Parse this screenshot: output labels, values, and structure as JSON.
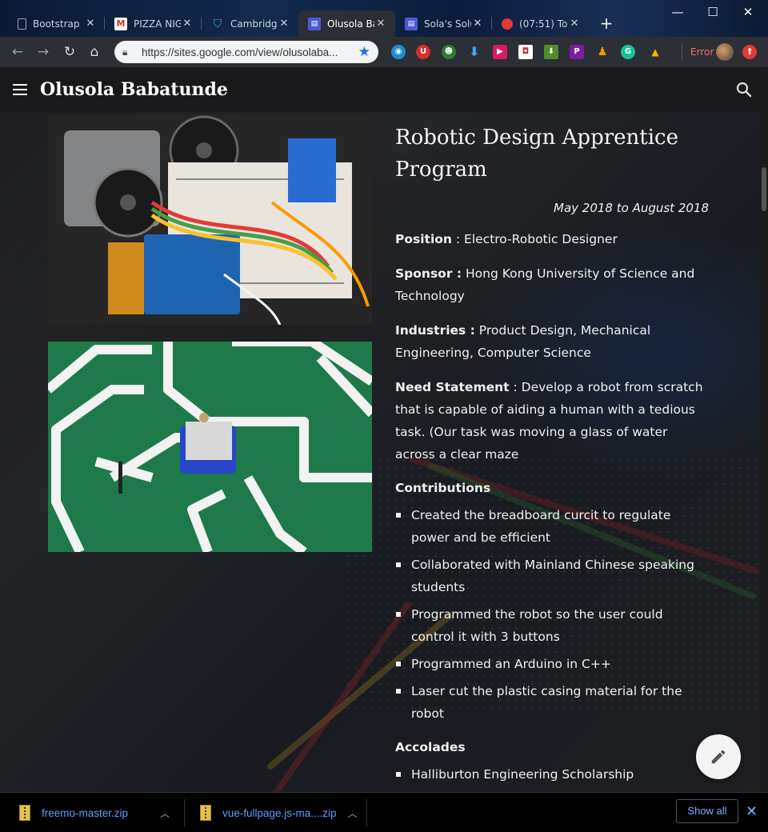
{
  "browser": {
    "tabs": [
      {
        "title": "Bootstrap",
        "icon": "document-icon"
      },
      {
        "title": "PIZZA NIG",
        "icon": "gmail-icon"
      },
      {
        "title": "Cambridge",
        "icon": "cambridge-icon"
      },
      {
        "title": "Olusola Ba",
        "icon": "google-sites-icon",
        "active": true
      },
      {
        "title": "Sola's Solu",
        "icon": "google-sites-icon"
      },
      {
        "title": "(07:51) To",
        "icon": "tomato-icon"
      }
    ],
    "url": "https://sites.google.com/view/olusolaba...",
    "error_label": "Error",
    "window_controls": {
      "minimize": "—",
      "maximize": "☐",
      "close": "✕"
    }
  },
  "site": {
    "title": "Olusola Babatunde"
  },
  "content": {
    "headline": "Robotic Design Apprentice Program",
    "dates": "May 2018 to August 2018",
    "position_label": "Position",
    "position_value": " : Electro-Robotic Designer",
    "sponsor_label": "Sponsor :",
    "sponsor_value": "  Hong Kong University of Science and Technology",
    "industries_label": "Industries :",
    "industries_value": " Product Design, Mechanical Engineering, Computer Science",
    "need_label": "Need Statement",
    "need_value": " : Develop a robot from scratch that is capable of aiding a human with a tedious task. (Our task was moving a glass of water across a clear maze",
    "contributions_heading": "Contributions",
    "contributions": [
      "Created the breadboard curcit  to regulate power and be efficient",
      "Collaborated with Mainland Chinese speaking students",
      "Programmed the robot so the user could control it with 3 buttons",
      "Programmed an Arduino  in C++",
      "Laser cut the plastic casing material for the robot"
    ],
    "accolades_heading": "Accolades",
    "accolades": [
      "Halliburton Engineering Scholarship"
    ]
  },
  "downloads": {
    "items": [
      {
        "name": "freemo-master.zip"
      },
      {
        "name": "vue-fullpage.js-ma....zip"
      }
    ],
    "show_all_label": "Show all"
  },
  "colors": {
    "chrome_bg": "#2c2f36",
    "site_header_bg": "#19191b",
    "link_blue": "#5b9cff",
    "maze_green": "#1f7a4b"
  }
}
